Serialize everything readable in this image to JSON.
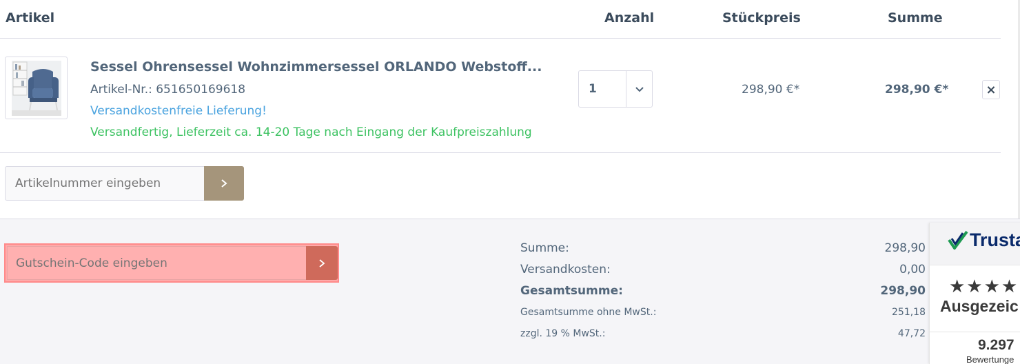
{
  "table_header": {
    "article": "Artikel",
    "quantity": "Anzahl",
    "unit_price": "Stückpreis",
    "total": "Summe"
  },
  "cart_item": {
    "title": "Sessel Ohrensessel Wohnzimmersessel ORLANDO Webstoff...",
    "article_number": "Artikel-Nr.: 651650169618",
    "shipping_info": "Versandkostenfreie Lieferung!",
    "delivery_info": "Versandfertig, Lieferzeit ca. 14-20 Tage nach Eingang der Kaufpreiszahlung",
    "quantity": "1",
    "unit_price": "298,90 €*",
    "line_total": "298,90 €*",
    "remove_label": "×",
    "thumbnail_icon": "armchair-thumbnail"
  },
  "add_article": {
    "placeholder": "Artikelnummer eingeben",
    "submit_icon": "chevron-right-icon"
  },
  "coupon": {
    "placeholder": "Gutschein-Code eingeben",
    "submit_icon": "chevron-right-icon"
  },
  "summary": {
    "rows": [
      {
        "label": "Summe:",
        "value": "298,90"
      },
      {
        "label": "Versandkosten:",
        "value": "0,00"
      },
      {
        "label": "Gesamtsumme:",
        "value": "298,90"
      },
      {
        "label": "Gesamtsumme ohne MwSt.:",
        "value": "251,18"
      },
      {
        "label": "zzgl. 19 % MwSt.:",
        "value": "47,72"
      }
    ]
  },
  "trust_badge": {
    "logo_text": "Trusta",
    "stars": "★★★★",
    "award_text": "Ausgezeic",
    "review_count": "9.297",
    "reviews_label": "Bewertunge"
  },
  "colors": {
    "text": "#52667a",
    "shipping_blue": "#4aa3df",
    "delivery_green": "#3cc261",
    "brand_button": "#a5957b",
    "coupon_highlight": "#ffaaaa",
    "coupon_button": "#cf6a5b"
  }
}
